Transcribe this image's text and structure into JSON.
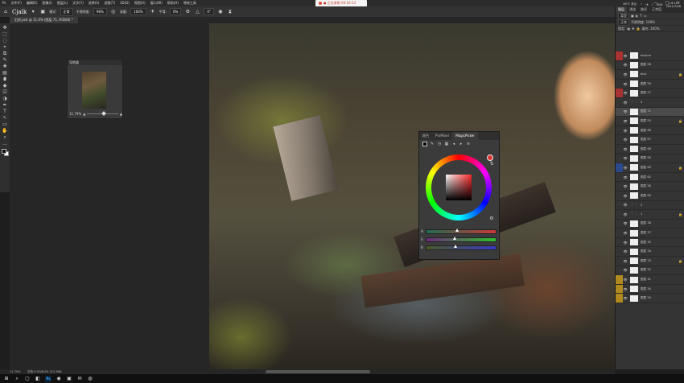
{
  "menubar": {
    "items": [
      "文件(F)",
      "编辑(E)",
      "图像(I)",
      "图层(L)",
      "文字(Y)",
      "选择(S)",
      "滤镜(T)",
      "3D(D)",
      "视图(V)",
      "窗口(W)",
      "帮助(H)",
      "增效工具"
    ],
    "recording": "● 正在录制 00:10:13"
  },
  "window_controls": {
    "minimize": "—",
    "maximize": "□",
    "close": "✕"
  },
  "optionsbar": {
    "tool_preset": "Cjalk",
    "mode_label": "模式:",
    "mode_value": "正常",
    "opacity_label": "不透明度:",
    "opacity_value": "96%",
    "flow_label": "流量:",
    "flow_value": "100%",
    "smooth_label": "平滑:",
    "smooth_value": "0%",
    "angle_value": "0°"
  },
  "document": {
    "tab_title": "石阶.psd @ 11.6% (图层 71, RGB/8) *"
  },
  "toolbar": {
    "tools": [
      "✥",
      "⬚",
      "◌",
      "⌖",
      "⧉",
      "✎",
      "✚",
      "▤",
      "⬮",
      "◆",
      "⎚",
      "◑",
      "✒",
      "T",
      "↖",
      "▭",
      "✋",
      "⌕",
      "…"
    ]
  },
  "navigator": {
    "title": "导航器",
    "zoom": "11.79%"
  },
  "color_picker": {
    "tabs": [
      "颜色",
      "ProMixer",
      "MagicPicker"
    ],
    "active_tab": "MagicPicker",
    "current_color": "#000000",
    "hue_color": "#ff2a2a",
    "sliders": [
      {
        "label": "H",
        "value": 0.42,
        "color": "linear-gradient(to right, #1f6b4f, #c73a3a)"
      },
      {
        "label": "S",
        "value": 0.38,
        "color": "linear-gradient(to right, #6a2a7a, #2fbf2f)"
      },
      {
        "label": "B",
        "value": 0.4,
        "color": "linear-gradient(to right, #4a5a2a, #3a3ac0)"
      }
    ]
  },
  "right_panel": {
    "tabs": [
      "图层",
      "通道",
      "路径",
      "正常值"
    ],
    "active_tab": "图层",
    "kind_label": "类型",
    "blend_mode": "正常",
    "opacity_label": "不透明度: 100%",
    "lock_label": "锁定:",
    "fill_label": "填充: 100%",
    "layers": [
      {
        "name": "texture",
        "color": "#a83232",
        "thumb": "layer",
        "active": false
      },
      {
        "name": "图层 58",
        "color": "",
        "thumb": "layer",
        "active": false
      },
      {
        "name": "blox",
        "color": "",
        "thumb": "layer",
        "active": false
      },
      {
        "name": "图层 56",
        "color": "",
        "thumb": "layer",
        "active": false
      },
      {
        "name": "图层 57",
        "color": "#a83232",
        "thumb": "layer",
        "active": false
      },
      {
        "name": "3",
        "color": "",
        "thumb": "folder",
        "active": false
      },
      {
        "name": "图层 71",
        "color": "",
        "thumb": "layer",
        "active": true
      },
      {
        "name": "图层 55",
        "color": "",
        "thumb": "layer",
        "active": false
      },
      {
        "name": "图层 68",
        "color": "",
        "thumb": "layer",
        "active": false
      },
      {
        "name": "图层 67",
        "color": "",
        "thumb": "layer",
        "active": false
      },
      {
        "name": "图层 66",
        "color": "",
        "thumb": "layer",
        "active": false
      },
      {
        "name": "图层 69",
        "color": "",
        "thumb": "layer",
        "active": false
      },
      {
        "name": "图层 63",
        "color": "#2b4a8c",
        "thumb": "layer",
        "active": false
      },
      {
        "name": "图层 62",
        "color": "",
        "thumb": "layer",
        "active": false
      },
      {
        "name": "图层 58",
        "color": "",
        "thumb": "layer",
        "active": false
      },
      {
        "name": "图层 60",
        "color": "",
        "thumb": "layer",
        "active": false
      },
      {
        "name": "2",
        "color": "",
        "thumb": "folder",
        "active": false
      },
      {
        "name": "1",
        "color": "",
        "thumb": "folder",
        "active": false
      },
      {
        "name": "图层 38",
        "color": "",
        "thumb": "layer",
        "active": false
      },
      {
        "name": "图层 37",
        "color": "",
        "thumb": "layer",
        "active": false
      },
      {
        "name": "图层 35",
        "color": "",
        "thumb": "layer",
        "active": false
      },
      {
        "name": "图层 34",
        "color": "",
        "thumb": "layer",
        "active": false
      },
      {
        "name": "图层 33",
        "color": "",
        "thumb": "layer",
        "active": false
      },
      {
        "name": "图层 32",
        "color": "",
        "thumb": "layer",
        "active": false
      },
      {
        "name": "图层 31",
        "color": "#b08a1e",
        "thumb": "layer",
        "active": false
      },
      {
        "name": "图层 30",
        "color": "#b08a1e",
        "thumb": "layer",
        "active": false
      },
      {
        "name": "图层 29",
        "color": "#b08a1e",
        "thumb": "layer",
        "active": false
      }
    ],
    "footer_icons": [
      "fx",
      "◐",
      "▭",
      "🗀",
      "+",
      "🗑"
    ]
  },
  "statusbar": {
    "zoom": "11.79%",
    "doc_info": "文档:3.0G/8.0G (3.0 MB)"
  },
  "taskbar": {
    "icons": [
      "⊞",
      "⌕",
      "▢",
      "◧",
      "Ps",
      "◉",
      "▣",
      "✉",
      "◍"
    ],
    "weather": "26°C 多云",
    "lang": "ENG",
    "time": "14:12",
    "date": "2021/7/26"
  }
}
